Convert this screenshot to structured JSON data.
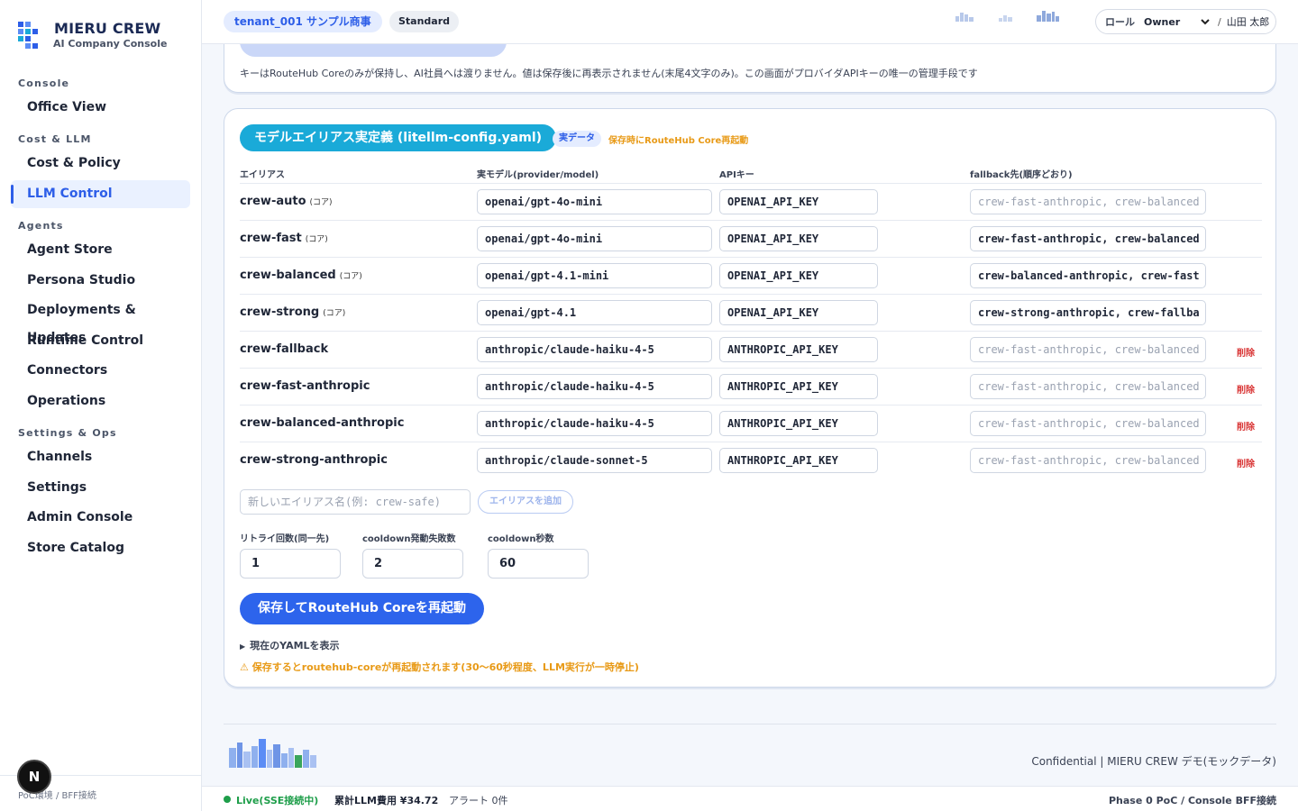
{
  "brand": {
    "title": "MIERU CREW",
    "subtitle": "AI Company Console"
  },
  "sidebar": {
    "sections": [
      {
        "label": "Console",
        "items": [
          {
            "label": "Office View",
            "active": false
          }
        ]
      },
      {
        "label": "Cost & LLM",
        "items": [
          {
            "label": "Cost & Policy",
            "active": false
          },
          {
            "label": "LLM Control",
            "active": true
          }
        ]
      },
      {
        "label": "Agents",
        "items": [
          {
            "label": "Agent Store"
          },
          {
            "label": "Persona Studio"
          },
          {
            "label": "Deployments & Updates"
          },
          {
            "label": "Runtime Control"
          },
          {
            "label": "Connectors"
          },
          {
            "label": "Operations"
          }
        ]
      },
      {
        "label": "Settings & Ops",
        "items": [
          {
            "label": "Channels"
          },
          {
            "label": "Settings"
          },
          {
            "label": "Admin Console"
          },
          {
            "label": "Store Catalog"
          }
        ]
      }
    ],
    "footer": "PoC環境 / BFF接続",
    "badge": "N"
  },
  "header": {
    "tenant": "tenant_001 サンプル商事",
    "plan": "Standard",
    "role_label": "ロール",
    "role_value": "Owner",
    "separator": "/",
    "user": "山田 太郎"
  },
  "top_card": {
    "note": "キーはRouteHub Coreのみが保持し、AI社員へは渡りません。値は保存後に再表示されません(末尾4文字のみ)。この画面がプロバイダAPIキーの唯一の管理手段です"
  },
  "alias_card": {
    "title": "モデルエイリアス実定義 (litellm-config.yaml)",
    "badge_real": "実データ",
    "badge_warn": "保存時にRouteHub Core再起動",
    "columns": {
      "alias": "エイリアス",
      "model": "実モデル(provider/model)",
      "key": "APIキー",
      "fallback": "fallback先(順序どおり)"
    },
    "core_tag": "(コア)",
    "delete_label": "削除",
    "rows": [
      {
        "alias": "crew-auto",
        "core": true,
        "model": "openai/gpt-4o-mini",
        "key": "OPENAI_API_KEY",
        "fallback": "crew-fast-anthropic, crew-balanced",
        "fallback_placeholder": true,
        "deletable": false
      },
      {
        "alias": "crew-fast",
        "core": true,
        "model": "openai/gpt-4o-mini",
        "key": "OPENAI_API_KEY",
        "fallback": "crew-fast-anthropic, crew-balanced",
        "fallback_placeholder": false,
        "deletable": false
      },
      {
        "alias": "crew-balanced",
        "core": true,
        "model": "openai/gpt-4.1-mini",
        "key": "OPENAI_API_KEY",
        "fallback": "crew-balanced-anthropic, crew-fast",
        "fallback_placeholder": false,
        "deletable": false
      },
      {
        "alias": "crew-strong",
        "core": true,
        "model": "openai/gpt-4.1",
        "key": "OPENAI_API_KEY",
        "fallback": "crew-strong-anthropic, crew-fallba",
        "fallback_placeholder": false,
        "deletable": false
      },
      {
        "alias": "crew-fallback",
        "core": false,
        "model": "anthropic/claude-haiku-4-5",
        "key": "ANTHROPIC_API_KEY",
        "fallback": "crew-fast-anthropic, crew-balanced",
        "fallback_placeholder": true,
        "deletable": true
      },
      {
        "alias": "crew-fast-anthropic",
        "core": false,
        "model": "anthropic/claude-haiku-4-5",
        "key": "ANTHROPIC_API_KEY",
        "fallback": "crew-fast-anthropic, crew-balanced",
        "fallback_placeholder": true,
        "deletable": true
      },
      {
        "alias": "crew-balanced-anthropic",
        "core": false,
        "model": "anthropic/claude-haiku-4-5",
        "key": "ANTHROPIC_API_KEY",
        "fallback": "crew-fast-anthropic, crew-balanced",
        "fallback_placeholder": true,
        "deletable": true
      },
      {
        "alias": "crew-strong-anthropic",
        "core": false,
        "model": "anthropic/claude-sonnet-5",
        "key": "ANTHROPIC_API_KEY",
        "fallback": "crew-fast-anthropic, crew-balanced",
        "fallback_placeholder": true,
        "deletable": true
      }
    ],
    "new_alias_placeholder": "新しいエイリアス名(例: crew-safe)",
    "add_button": "エイリアスを追加",
    "retry_label": "リトライ回数(同一先)",
    "retry_value": "1",
    "cooldown_fail_label": "cooldown発動失敗数",
    "cooldown_fail_value": "2",
    "cooldown_sec_label": "cooldown秒数",
    "cooldown_sec_value": "60",
    "save_button": "保存してRouteHub Coreを再起動",
    "yaml_toggle": "現在のYAMLを表示",
    "warning": "⚠ 保存するとroutehub-coreが再起動されます(30〜60秒程度、LLM実行が一時停止)"
  },
  "footer": {
    "text": "Confidential | MIERU CREW デモ(モックデータ)"
  },
  "status": {
    "live": "Live(SSE接続中)",
    "cost": "累計LLM費用 ¥34.72",
    "alerts": "アラート 0件",
    "phase": "Phase 0 PoC / Console BFF接続"
  },
  "colors": {
    "accent": "#2d5ee8",
    "title_pill": "#1aaad8",
    "live": "#1e9e4a",
    "warn": "#e89a17",
    "delete": "#d93636"
  }
}
